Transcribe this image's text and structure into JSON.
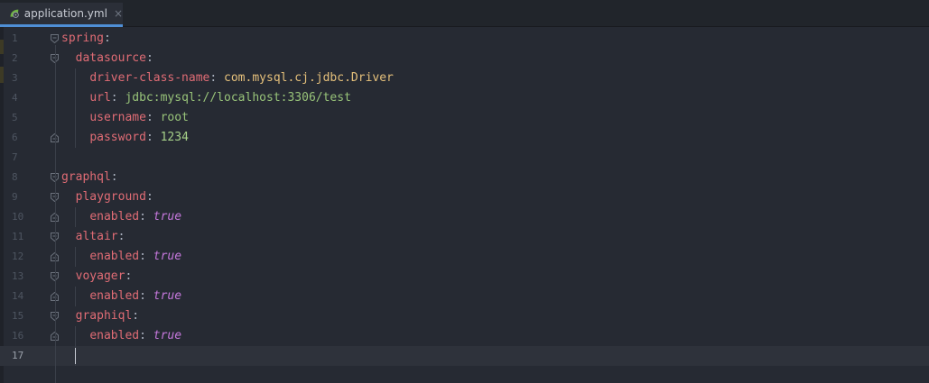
{
  "tab": {
    "filename": "application.yml",
    "close_symbol": "×",
    "icon": "spring-leaf-icon",
    "accent": "#4f8fd6"
  },
  "colors": {
    "key": "#e06c75",
    "string": "#e5c07b",
    "url": "#98c379",
    "number": "#a6d189",
    "boolean": "#c678dd"
  },
  "editor": {
    "current_line": 17,
    "lines": [
      {
        "num": "1",
        "indent": "",
        "key": "spring",
        "sep": ":",
        "value": "",
        "vtype": ""
      },
      {
        "num": "2",
        "indent": "  ",
        "key": "datasource",
        "sep": ":",
        "value": "",
        "vtype": ""
      },
      {
        "num": "3",
        "indent": "    ",
        "key": "driver-class-name",
        "sep": ": ",
        "value": "com.mysql.cj.jdbc.Driver",
        "vtype": "s"
      },
      {
        "num": "4",
        "indent": "    ",
        "key": "url",
        "sep": ": ",
        "value": "jdbc:mysql://localhost:3306/test",
        "vtype": "v"
      },
      {
        "num": "5",
        "indent": "    ",
        "key": "username",
        "sep": ": ",
        "value": "root",
        "vtype": "v"
      },
      {
        "num": "6",
        "indent": "    ",
        "key": "password",
        "sep": ": ",
        "value": "1234",
        "vtype": "n"
      },
      {
        "num": "7",
        "indent": "",
        "key": "",
        "sep": "",
        "value": "",
        "vtype": ""
      },
      {
        "num": "8",
        "indent": "",
        "key": "graphql",
        "sep": ":",
        "value": "",
        "vtype": ""
      },
      {
        "num": "9",
        "indent": "  ",
        "key": "playground",
        "sep": ":",
        "value": "",
        "vtype": ""
      },
      {
        "num": "10",
        "indent": "    ",
        "key": "enabled",
        "sep": ": ",
        "value": "true",
        "vtype": "b"
      },
      {
        "num": "11",
        "indent": "  ",
        "key": "altair",
        "sep": ":",
        "value": "",
        "vtype": ""
      },
      {
        "num": "12",
        "indent": "    ",
        "key": "enabled",
        "sep": ": ",
        "value": "true",
        "vtype": "b"
      },
      {
        "num": "13",
        "indent": "  ",
        "key": "voyager",
        "sep": ":",
        "value": "",
        "vtype": ""
      },
      {
        "num": "14",
        "indent": "    ",
        "key": "enabled",
        "sep": ": ",
        "value": "true",
        "vtype": "b"
      },
      {
        "num": "15",
        "indent": "  ",
        "key": "graphiql",
        "sep": ":",
        "value": "",
        "vtype": ""
      },
      {
        "num": "16",
        "indent": "    ",
        "key": "enabled",
        "sep": ": ",
        "value": "true",
        "vtype": "b"
      },
      {
        "num": "17",
        "indent": "",
        "key": "",
        "sep": "",
        "value": "",
        "vtype": ""
      }
    ]
  }
}
